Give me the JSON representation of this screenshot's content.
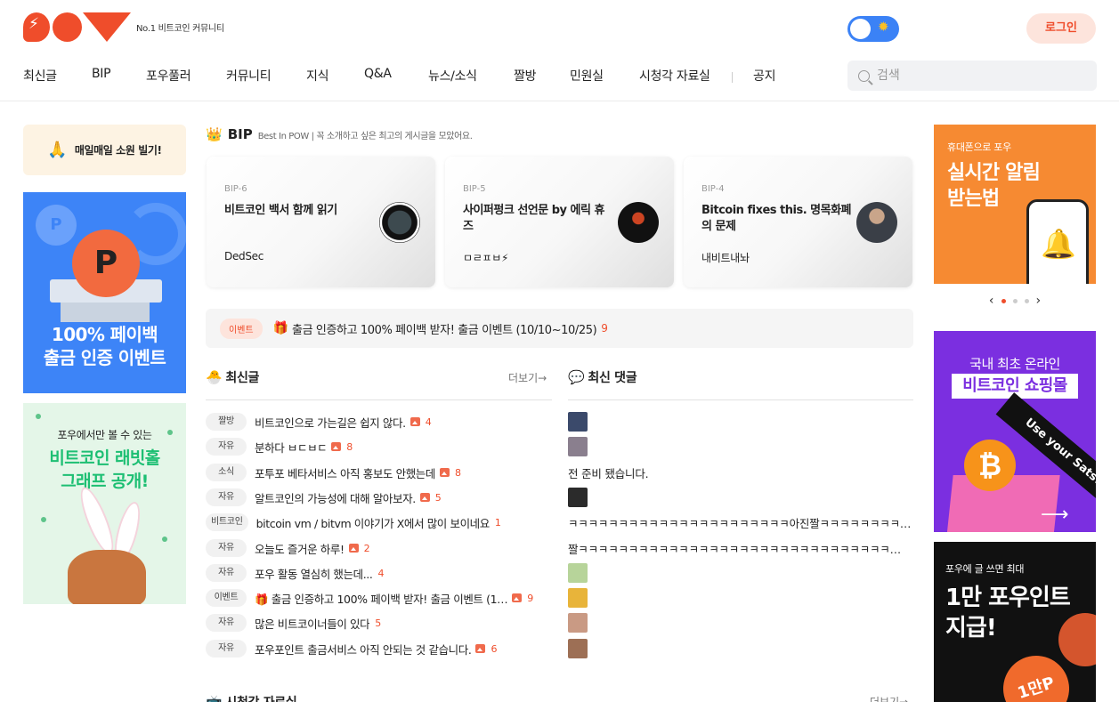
{
  "header": {
    "logo_text": "POW",
    "tagline": "No.1 비트코인 커뮤니티",
    "login_label": "로그인"
  },
  "nav": {
    "items": [
      "최신글",
      "BIP",
      "포우풀러",
      "커뮤니티",
      "지식",
      "Q&A",
      "뉴스/소식",
      "짤방",
      "민원실",
      "시청각 자료실",
      "공지"
    ],
    "search_placeholder": "검색"
  },
  "left": {
    "wish_label": "매일매일 소원 빌기!",
    "payback_coin": "P",
    "payback_lines": [
      "100% 페이백",
      "출금 인증 이벤트"
    ],
    "rabbit_line1": "포우에서만 볼 수 있는",
    "rabbit_lines": [
      "비트코인 래빗홀",
      "그래프 공개!"
    ]
  },
  "bip": {
    "title": "BIP",
    "subtitle": "Best In POW | 꼭 소개하고 싶은 최고의 게시글을 모았어요.",
    "cards": [
      {
        "no": "BIP-6",
        "title": "비트코인 백서 함께 읽기",
        "author": "DedSec"
      },
      {
        "no": "BIP-5",
        "title": "사이퍼펑크 선언문 by 에릭 휴즈",
        "author": "ㅁㄹㅍㅂ⚡"
      },
      {
        "no": "BIP-4",
        "title": "Bitcoin fixes this. 명목화폐의 문제",
        "author": "내비트내놔"
      }
    ]
  },
  "event": {
    "badge": "이벤트",
    "text": "출금 인증하고 100% 페이백 받자! 출금 이벤트 (10/10~10/25)",
    "count": "9"
  },
  "latest": {
    "title": "최신글",
    "more": "더보기→",
    "posts": [
      {
        "cat": "짤방",
        "title": "비트코인으로 가는길은 쉽지 않다.",
        "img": true,
        "count": "4"
      },
      {
        "cat": "자유",
        "title": "분하다 ㅂㄷㅂㄷ",
        "img": true,
        "count": "8"
      },
      {
        "cat": "소식",
        "title": "포투포 베타서비스 아직 홍보도 안했는데",
        "img": true,
        "count": "8"
      },
      {
        "cat": "자유",
        "title": "알트코인의 가능성에 대해 알아보자.",
        "img": true,
        "count": "5"
      },
      {
        "cat": "비트코인",
        "title": "bitcoin vm / bitvm 이야기가 X에서 많이 보이네요",
        "img": false,
        "count": "1"
      },
      {
        "cat": "자유",
        "title": "오늘도 즐거운 하루!",
        "img": true,
        "count": "2"
      },
      {
        "cat": "자유",
        "title": "포우 활동 열심히 했는데...",
        "img": false,
        "count": "4"
      },
      {
        "cat": "이벤트",
        "title": "🎁 출금 인증하고 100% 페이백 받자! 출금 이벤트 (1…",
        "img": true,
        "count": "9"
      },
      {
        "cat": "자유",
        "title": "많은 비트코이너들이 있다",
        "img": false,
        "count": "5"
      },
      {
        "cat": "자유",
        "title": "포우포인트 출금서비스 아직 안되는 것 같습니다.",
        "img": true,
        "count": "6"
      }
    ]
  },
  "comments": {
    "title": "최신 댓글",
    "items": [
      {
        "type": "image",
        "color": "#3b4a6b"
      },
      {
        "type": "image",
        "color": "#8a7f8e"
      },
      {
        "type": "text",
        "text": "전 준비 됐습니다."
      },
      {
        "type": "image",
        "color": "#2b2b2b"
      },
      {
        "type": "text",
        "text": "ㅋㅋㅋㅋㅋㅋㅋㅋㅋㅋㅋㅋㅋㅋㅋㅋㅋㅋㅋㅋㅋㅋ아진짤ㅋㅋㅋㅋㅋㅋㅋㅋ…"
      },
      {
        "type": "text",
        "text": "짤ㅋㅋㅋㅋㅋㅋㅋㅋㅋㅋㅋㅋㅋㅋㅋㅋㅋㅋㅋㅋㅋㅋㅋㅋㅋㅋㅋㅋㅋㅋㅋ…"
      },
      {
        "type": "image",
        "color": "#b7d49a"
      },
      {
        "type": "image",
        "color": "#e8b43a"
      },
      {
        "type": "image",
        "color": "#c99a84"
      },
      {
        "type": "image",
        "color": "#9d6f55"
      }
    ]
  },
  "media_section": {
    "title": "시청각 자료실",
    "more": "더보기→"
  },
  "right": {
    "alarm_small": "휴대폰으로 포우",
    "alarm_lines": [
      "실시간 알림",
      "받는법"
    ],
    "shop_top": "국내 최초 온라인",
    "shop_main": "비트코인 쇼핑몰",
    "shop_ribbon": "Use your Sats!",
    "shop_btc": "₿",
    "point_small": "포우에 글 쓰면 최대",
    "point_lines": [
      "1만 포우인트",
      "지급!"
    ],
    "point_coin": "1만P"
  },
  "colors": {
    "brand": "#ef4d2b",
    "toggle": "#3b82f6"
  }
}
